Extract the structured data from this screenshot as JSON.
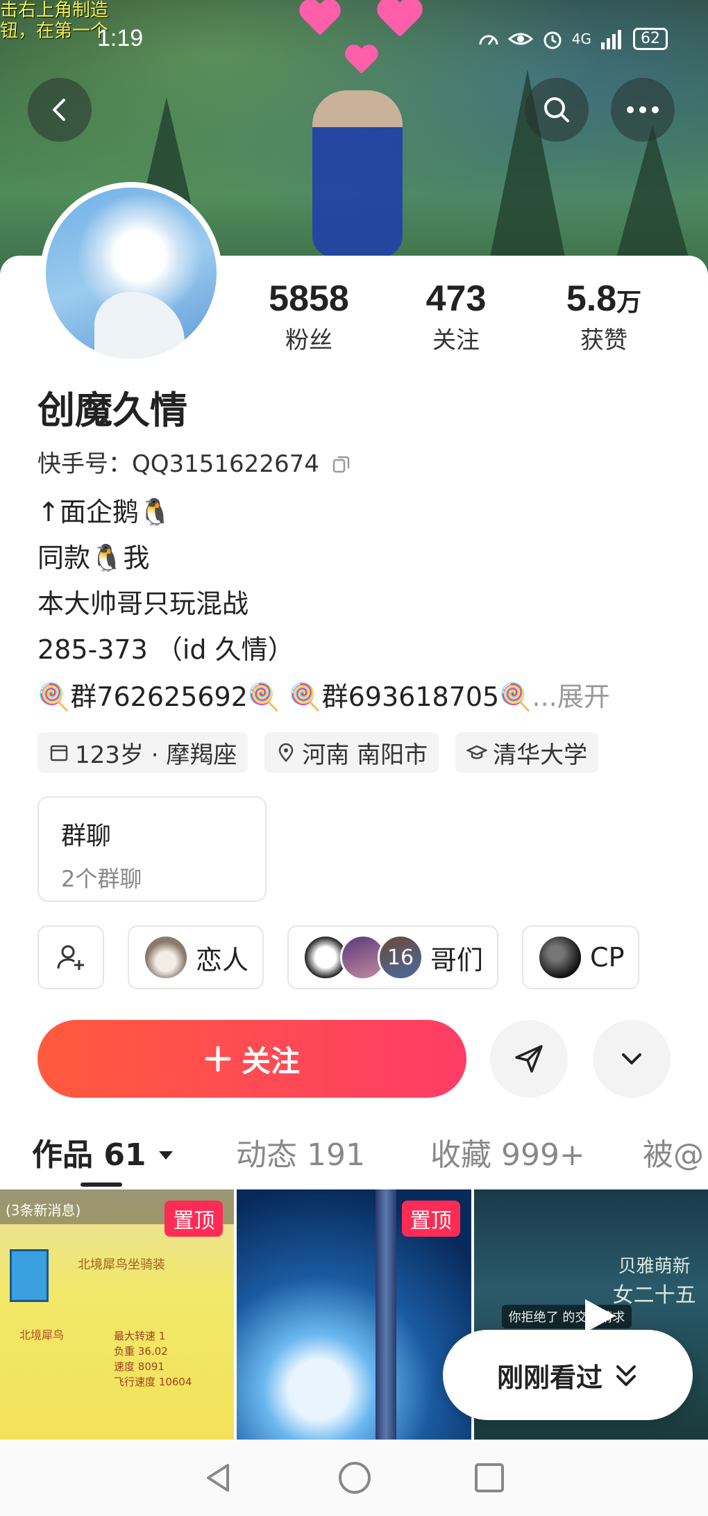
{
  "statusbar": {
    "time": "1:19",
    "network": "4G",
    "battery": "62"
  },
  "banner": {
    "game_text_line1": "击右上角制造",
    "game_text_line2": "钮，在第一个"
  },
  "profile": {
    "name": "创魔久情",
    "kuaishou_id_label": "快手号：",
    "kuaishou_id": "QQ3151622674",
    "stats": [
      {
        "num": "5858",
        "unit": "",
        "label": "粉丝"
      },
      {
        "num": "473",
        "unit": "",
        "label": "关注"
      },
      {
        "num": "5.8",
        "unit": "万",
        "label": "获赞"
      }
    ],
    "bio": [
      "↑面企鹅🐧",
      "同款🐧我",
      "本大帅哥只玩混战",
      "285-373 （id 久情）",
      "🍭群762625692🍭 🍭群693618705🍭"
    ],
    "bio_expand": "...展开",
    "tags": [
      {
        "icon": "calendar-icon",
        "text": "123岁 · 摩羯座"
      },
      {
        "icon": "location-icon",
        "text": "河南 南阳市"
      },
      {
        "icon": "graduation-cap-icon",
        "text": "清华大学"
      }
    ]
  },
  "group_chat": {
    "title": "群聊",
    "subtitle": "2个群聊"
  },
  "relations": [
    {
      "label": "恋人"
    },
    {
      "label": "哥们",
      "count": "16"
    },
    {
      "label": "CP"
    }
  ],
  "actions": {
    "follow_label": "关注",
    "follow_icon": "plus-icon"
  },
  "tabs": [
    {
      "label": "作品 61"
    },
    {
      "label": "动态 191"
    },
    {
      "label": "收藏 999+"
    },
    {
      "label": "被@"
    }
  ],
  "grid": {
    "pinned_label": "置顶",
    "thumb1_top": "(3条新消息)",
    "thumb1_title": "北境犀鸟坐骑装",
    "thumb1_name": "北境犀鸟",
    "thumb1_stats": [
      [
        "最大转速",
        "1"
      ],
      [
        "负重",
        "36.02"
      ],
      [
        "速度",
        "8091"
      ],
      [
        "飞行速度",
        "10604"
      ]
    ],
    "thumb3_text1": "贝雅萌新",
    "thumb3_text2": "女二十五",
    "thumb3_msg": "你拒绝了",
    "thumb3_msg2": "的交易请求"
  },
  "recently_viewed": "刚刚看过",
  "colors": {
    "accent": "#fe2c55",
    "follow_start": "#ff5a3e",
    "follow_end": "#fe3d66"
  }
}
